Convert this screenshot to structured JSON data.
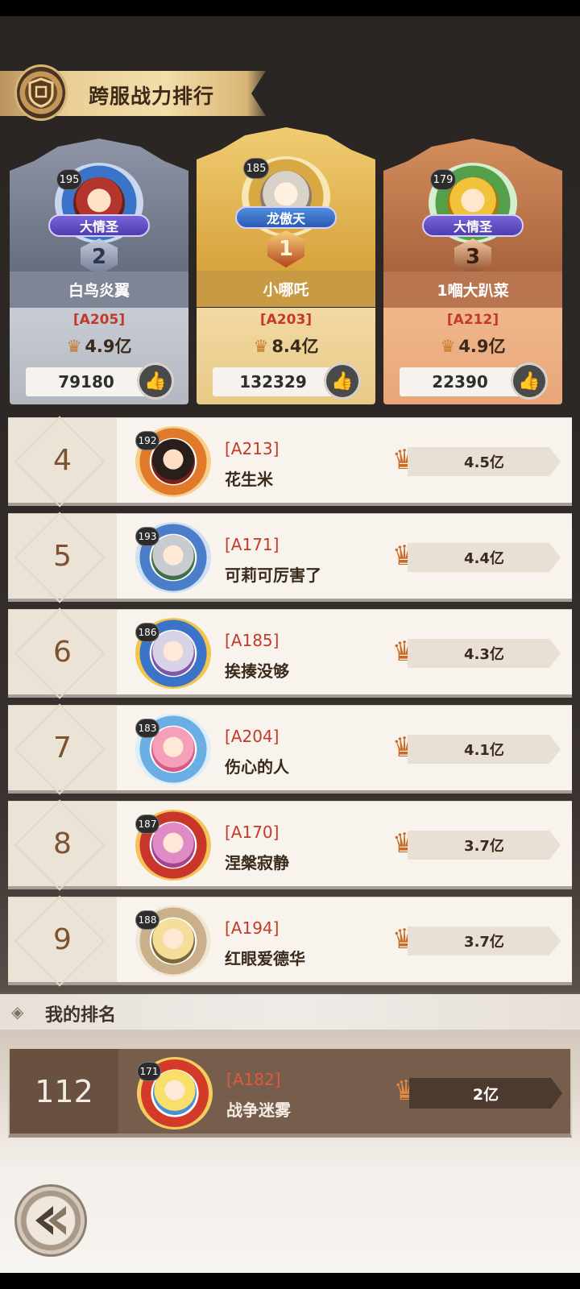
{
  "title": "跨服战力排行",
  "podium": [
    {
      "rank": "2",
      "level": "195",
      "title_tag": "大情圣",
      "name": "白鸟炎翼",
      "server": "[A205]",
      "power": "4.9亿",
      "likes": "79180"
    },
    {
      "rank": "1",
      "level": "185",
      "title_tag": "龙傲天",
      "name": "小哪吒",
      "server": "[A203]",
      "power": "8.4亿",
      "likes": "132329"
    },
    {
      "rank": "3",
      "level": "179",
      "title_tag": "大情圣",
      "name": "1嗰大趴菜",
      "server": "[A212]",
      "power": "4.9亿",
      "likes": "22390"
    }
  ],
  "rows": [
    {
      "rank": "4",
      "level": "192",
      "server": "[A213]",
      "name": "花生米",
      "power": "4.5亿"
    },
    {
      "rank": "5",
      "level": "193",
      "server": "[A171]",
      "name": "可莉可厉害了",
      "power": "4.4亿"
    },
    {
      "rank": "6",
      "level": "186",
      "server": "[A185]",
      "name": "挨揍没够",
      "power": "4.3亿"
    },
    {
      "rank": "7",
      "level": "183",
      "server": "[A204]",
      "name": "伤心的人",
      "power": "4.1亿"
    },
    {
      "rank": "8",
      "level": "187",
      "server": "[A170]",
      "name": "涅槃寂静",
      "power": "3.7亿"
    },
    {
      "rank": "9",
      "level": "188",
      "server": "[A194]",
      "name": "红眼爱德华",
      "power": "3.7亿"
    }
  ],
  "my_rank": {
    "header": "我的排名",
    "rank": "112",
    "level": "171",
    "server": "[A182]",
    "name": "战争迷雾",
    "power": "2亿"
  },
  "icons": {
    "power": "power-crest-icon",
    "like": "thumbs-up-icon",
    "back": "back-arrow-icon"
  },
  "colors": {
    "server_text": "#c23b2a",
    "gold_card": "#e4b45a",
    "silver_card": "#8f96a8",
    "bronze_card": "#d98f5c"
  }
}
